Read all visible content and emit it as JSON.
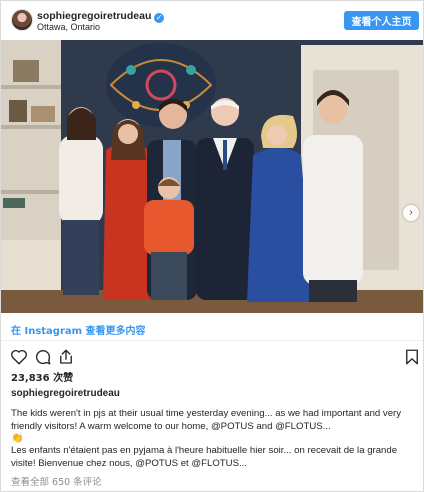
{
  "header": {
    "username": "sophiegregoiretrudeau",
    "location": "Ottawa, Ontario",
    "follow_label": "查看个人主页",
    "verified_glyph": "✓"
  },
  "photo": {
    "icon": "photo-family-group",
    "next_glyph": "›",
    "page_count": 2,
    "current_page": 1
  },
  "view_link": "在 Instagram 查看更多内容",
  "actions": {
    "icons": [
      "heart-icon",
      "comment-icon",
      "share-icon",
      "bookmark-icon"
    ]
  },
  "likes": "23,836 次赞",
  "caption": {
    "username": "sophiegregoiretrudeau",
    "english": "The kids weren't in pjs at their usual time yesterday evening... as we had important and very friendly visitors! A warm welcome to our home, @POTUS and @FLOTUS...",
    "emoji": "👏",
    "french": "Les enfants n'étaient pas en pyjama à l'heure habituelle hier soir... on recevait de la grande visite! Bienvenue chez nous, @POTUS et @FLOTUS..."
  },
  "comments_link": "查看全部 650 条评论",
  "colors": {
    "accent": "#3897f0",
    "text": "#262626",
    "muted": "#8e8e8e"
  }
}
